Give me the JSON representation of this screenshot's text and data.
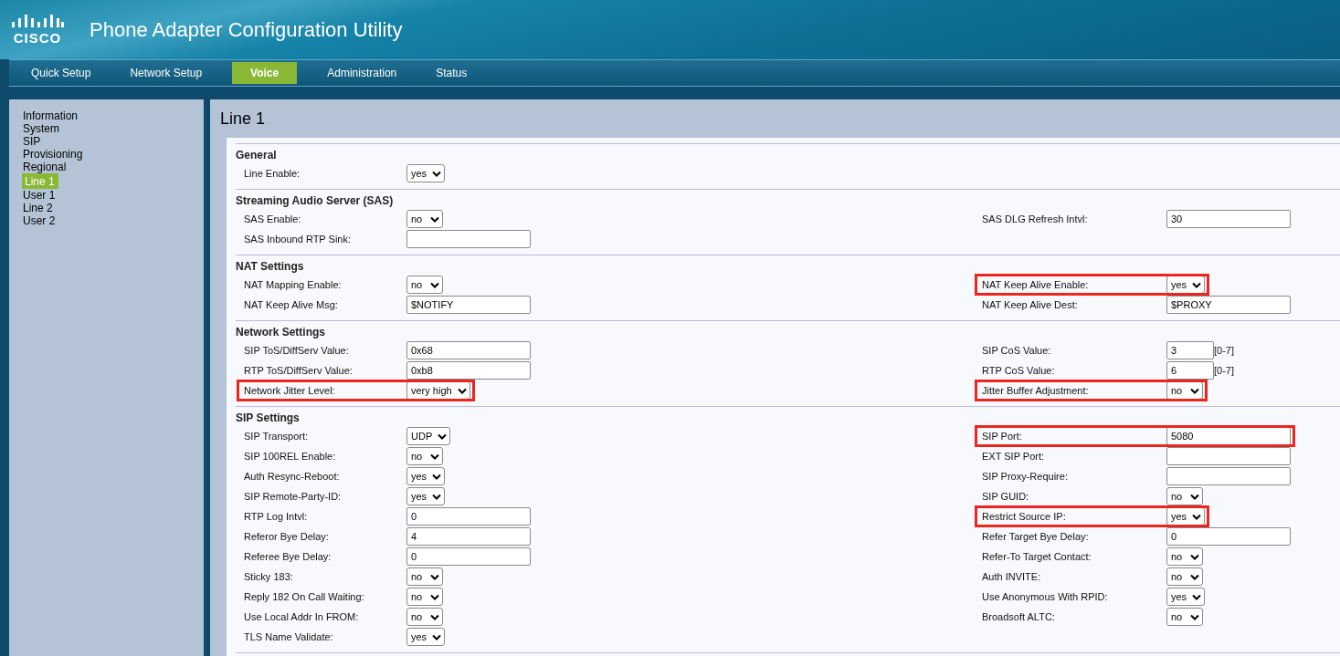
{
  "header": {
    "logo_text": "CISCO",
    "title": "Phone Adapter Configuration Utility"
  },
  "tabs": [
    {
      "label": "Quick Setup",
      "selected": false
    },
    {
      "label": "Network Setup",
      "selected": false
    },
    {
      "label": "Voice",
      "selected": true
    },
    {
      "label": "Administration",
      "selected": false
    },
    {
      "label": "Status",
      "selected": false
    }
  ],
  "sidebar": {
    "items": [
      {
        "label": "Information",
        "selected": false
      },
      {
        "label": "System",
        "selected": false
      },
      {
        "label": "SIP",
        "selected": false
      },
      {
        "label": "Provisioning",
        "selected": false
      },
      {
        "label": "Regional",
        "selected": false
      },
      {
        "label": "Line 1",
        "selected": true
      },
      {
        "label": "User 1",
        "selected": false
      },
      {
        "label": "Line 2",
        "selected": false
      },
      {
        "label": "User 2",
        "selected": false
      }
    ]
  },
  "page_title": "Line 1",
  "sections": [
    {
      "title": "General",
      "rows": [
        {
          "left": {
            "label": "Line Enable:",
            "kind": "select",
            "value": "yes",
            "highlighted": false
          }
        }
      ]
    },
    {
      "title": "Streaming Audio Server (SAS)",
      "rows": [
        {
          "left": {
            "label": "SAS Enable:",
            "kind": "select",
            "value": "no",
            "highlighted": false
          },
          "right": {
            "label": "SAS DLG Refresh Intvl:",
            "kind": "text",
            "value": "30",
            "highlighted": false
          }
        },
        {
          "left": {
            "label": "SAS Inbound RTP Sink:",
            "kind": "text",
            "highlighted": false
          }
        }
      ]
    },
    {
      "title": "NAT Settings",
      "rows": [
        {
          "left": {
            "label": "NAT Mapping Enable:",
            "kind": "select",
            "value": "no",
            "highlighted": false
          },
          "right": {
            "label": "NAT Keep Alive Enable:",
            "kind": "select",
            "value": "yes",
            "highlighted": true
          }
        },
        {
          "left": {
            "label": "NAT Keep Alive Msg:",
            "kind": "text",
            "value": "$NOTIFY",
            "highlighted": false
          },
          "right": {
            "label": "NAT Keep Alive Dest:",
            "kind": "text",
            "value": "$PROXY",
            "highlighted": false
          }
        }
      ]
    },
    {
      "title": "Network Settings",
      "rows": [
        {
          "left": {
            "label": "SIP ToS/DiffServ Value:",
            "kind": "text",
            "value": "0x68",
            "highlighted": false
          },
          "right": {
            "label": "SIP CoS Value:",
            "kind": "text",
            "value": "3",
            "hint": "[0-7]",
            "highlighted": false
          }
        },
        {
          "left": {
            "label": "RTP ToS/DiffServ Value:",
            "kind": "text",
            "value": "0xb8",
            "highlighted": false
          },
          "right": {
            "label": "RTP CoS Value:",
            "kind": "text",
            "value": "6",
            "hint": "[0-7]",
            "highlighted": false
          }
        },
        {
          "left": {
            "label": "Network Jitter Level:",
            "kind": "select",
            "value": "very high",
            "highlighted": true
          },
          "right": {
            "label": "Jitter Buffer Adjustment:",
            "kind": "select",
            "value": "no",
            "highlighted": true
          }
        }
      ]
    },
    {
      "title": "SIP Settings",
      "rows": [
        {
          "left": {
            "label": "SIP Transport:",
            "kind": "select",
            "value": "UDP",
            "highlighted": false
          },
          "right": {
            "label": "SIP Port:",
            "kind": "text",
            "value": "5080",
            "highlighted": true
          }
        },
        {
          "left": {
            "label": "SIP 100REL Enable:",
            "kind": "select",
            "value": "no",
            "highlighted": false
          },
          "right": {
            "label": "EXT SIP Port:",
            "kind": "text",
            "highlighted": false
          }
        },
        {
          "left": {
            "label": "Auth Resync-Reboot:",
            "kind": "select",
            "value": "yes",
            "highlighted": false
          },
          "right": {
            "label": "SIP Proxy-Require:",
            "kind": "text",
            "highlighted": false
          }
        },
        {
          "left": {
            "label": "SIP Remote-Party-ID:",
            "kind": "select",
            "value": "yes",
            "highlighted": false
          },
          "right": {
            "label": "SIP GUID:",
            "kind": "select",
            "value": "no",
            "highlighted": false
          }
        },
        {
          "left": {
            "label": "RTP Log Intvl:",
            "kind": "text",
            "value": "0",
            "highlighted": false
          },
          "right": {
            "label": "Restrict Source IP:",
            "kind": "select",
            "value": "yes",
            "highlighted": true
          }
        },
        {
          "left": {
            "label": "Referor Bye Delay:",
            "kind": "text",
            "value": "4",
            "highlighted": false
          },
          "right": {
            "label": "Refer Target Bye Delay:",
            "kind": "text",
            "value": "0",
            "highlighted": false
          }
        },
        {
          "left": {
            "label": "Referee Bye Delay:",
            "kind": "text",
            "value": "0",
            "highlighted": false
          },
          "right": {
            "label": "Refer-To Target Contact:",
            "kind": "select",
            "value": "no",
            "highlighted": false
          }
        },
        {
          "left": {
            "label": "Sticky 183:",
            "kind": "select",
            "value": "no",
            "highlighted": false
          },
          "right": {
            "label": "Auth INVITE:",
            "kind": "select",
            "value": "no",
            "highlighted": false
          }
        },
        {
          "left": {
            "label": "Reply 182 On Call Waiting:",
            "kind": "select",
            "value": "no",
            "highlighted": false
          },
          "right": {
            "label": "Use Anonymous With RPID:",
            "kind": "select",
            "value": "yes",
            "highlighted": false
          }
        },
        {
          "left": {
            "label": "Use Local Addr In FROM:",
            "kind": "select",
            "value": "no",
            "highlighted": false
          },
          "right": {
            "label": "Broadsoft ALTC:",
            "kind": "select",
            "value": "no",
            "highlighted": false
          }
        },
        {
          "left": {
            "label": "TLS Name Validate:",
            "kind": "select",
            "value": "yes",
            "highlighted": false
          }
        }
      ]
    }
  ]
}
